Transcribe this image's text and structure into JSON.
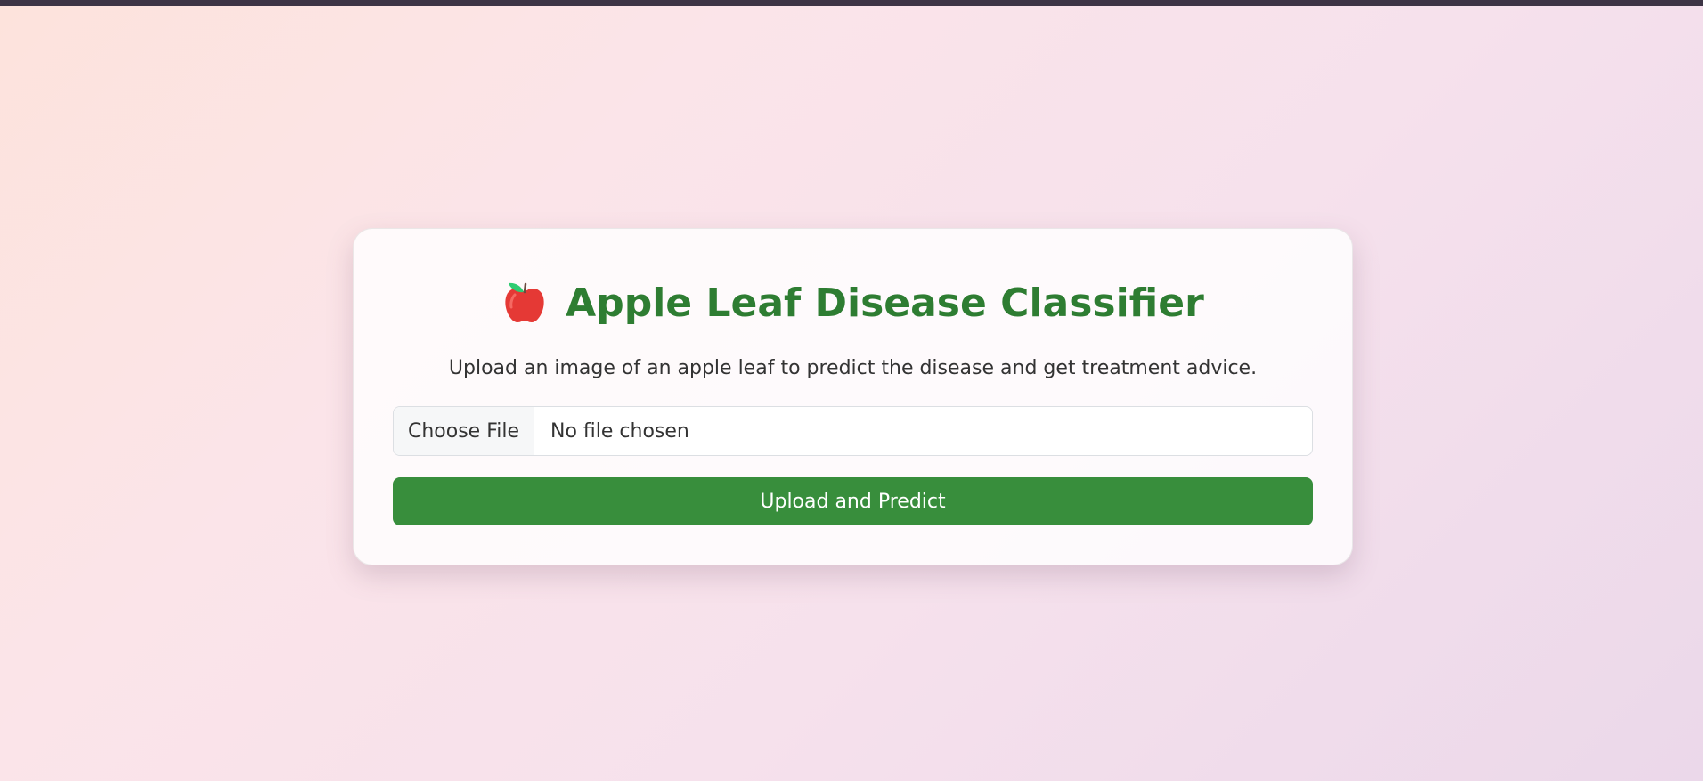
{
  "colors": {
    "title": "#2e7d32",
    "button_bg": "#388e3c",
    "button_text": "#ffffff",
    "apple": "#e53935",
    "leaf": "#2ecc71"
  },
  "header": {
    "icon": "apple-icon",
    "title": "Apple Leaf Disease Classifier",
    "subtitle": "Upload an image of an apple leaf to predict the disease and get treatment advice."
  },
  "form": {
    "file_button_label": "Choose File",
    "file_status": "No file chosen",
    "submit_label": "Upload and Predict"
  }
}
